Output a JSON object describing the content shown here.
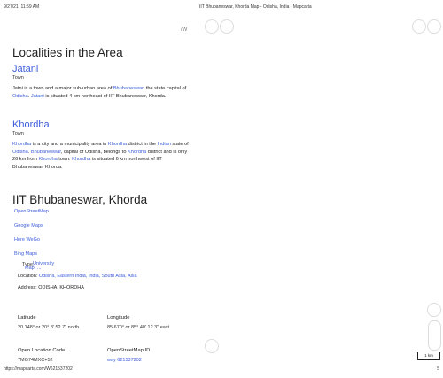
{
  "print_header": {
    "datetime": "9/27/21, 11:59 AM",
    "page_title": "IIT Bhubaneswar, Khorda Map - Odisha, India - Mapcarta"
  },
  "print_footer": {
    "url": "https://mapcarta.com/W621537202",
    "page_number": "5"
  },
  "collapse_glyph": "/W",
  "localities": {
    "heading": "Localities in the Area",
    "items": [
      {
        "name": "Jatani",
        "type": "Town",
        "desc": {
          "p1": "Jatni is a town and a major sub-urban area of ",
          "l1": "Bhubaneswar",
          "p2": ", the state capital of ",
          "l2": "Odisha",
          "p3": ". ",
          "l3": "Jatani",
          "p4": " is situated 4 km northeast of IIT Bhubaneswar, Khorda."
        }
      },
      {
        "name": "Khordha",
        "type": "Town",
        "desc": {
          "l1": "Khordha",
          "p1": " is a city and a municipality area in ",
          "l2": "Khordha",
          "p2": " district in the ",
          "l3": "Indian",
          "p3": " state of ",
          "l4": "Odisha",
          "p4": ". ",
          "l5": "Bhubaneswar",
          "p5": ", capital of Odisha, belongs to ",
          "l6": "Khordha",
          "p6": " district and is only 26 km from ",
          "l7": "Khordha",
          "p7": " town. ",
          "l8": "Khordha",
          "p8": " is situated 6 km northwest of IIT Bhubaneswar, Khorda."
        }
      }
    ]
  },
  "place": {
    "heading": "IIT Bhubaneswar, Khorda",
    "map_links": [
      "OpenStreetMap",
      "Google Maps",
      "Here WeGo",
      "Bing Maps"
    ],
    "overlay": {
      "type_label": "Type:",
      "type_value": "University",
      "map_word": "Map",
      "map_tail": "..."
    },
    "location_label": "Location:",
    "location_value": "Odisha, Eastern India, India, South Asia, Asia",
    "address_label": "Address:",
    "address_value": "ODISHA, KHORDHA",
    "latitude_label": "Latitude",
    "latitude_value": "20.148° or 20° 8' 52.7\" north",
    "longitude_label": "Longitude",
    "longitude_value": "85.670° or 85° 40' 12.3\" east",
    "olc_label": "Open Location Code",
    "olc_value": "7MG74MXC+52",
    "osm_label": "OpenStreetMap ID",
    "osm_value": "way 621537202"
  },
  "map_panel": {
    "scale_label": "1 km"
  },
  "colors": {
    "link": "#3b5bdb",
    "text": "#222222",
    "control_border": "#dcdcdc"
  }
}
